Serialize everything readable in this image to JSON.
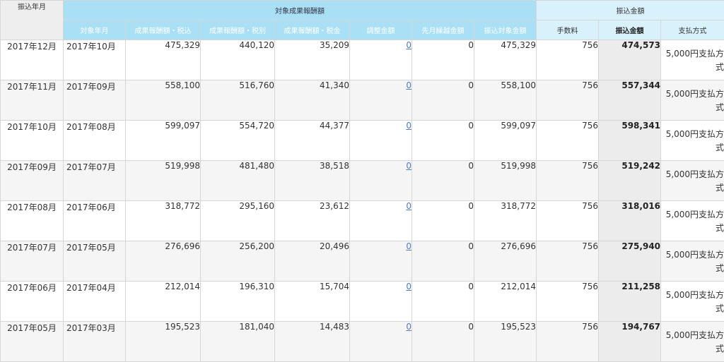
{
  "header": {
    "transfer_month": "振込年月",
    "group_reward": "対象成果報酬額",
    "group_transfer": "振込金額",
    "cols": {
      "target_month": "対象年月",
      "reward_incl_tax": "成果報酬額・税込",
      "reward_excl_tax": "成果報酬額・税別",
      "reward_tax": "成果報酬額・税金",
      "adjustment": "調整金額",
      "carryover": "先月繰越金額",
      "transfer_target": "振込対象金額",
      "fee": "手数料",
      "transfer_amount": "振込金額",
      "payment_method": "支払方式"
    }
  },
  "rows": [
    {
      "transfer_month": "2017年12月",
      "target_month": "2017年10月",
      "incl": "475,329",
      "excl": "440,120",
      "tax": "35,209",
      "adj": "0",
      "carry": "0",
      "target": "475,329",
      "fee": "756",
      "amount": "474,573",
      "method": "5,000円支払方式"
    },
    {
      "transfer_month": "2017年11月",
      "target_month": "2017年09月",
      "incl": "558,100",
      "excl": "516,760",
      "tax": "41,340",
      "adj": "0",
      "carry": "0",
      "target": "558,100",
      "fee": "756",
      "amount": "557,344",
      "method": "5,000円支払方式"
    },
    {
      "transfer_month": "2017年10月",
      "target_month": "2017年08月",
      "incl": "599,097",
      "excl": "554,720",
      "tax": "44,377",
      "adj": "0",
      "carry": "0",
      "target": "599,097",
      "fee": "756",
      "amount": "598,341",
      "method": "5,000円支払方式"
    },
    {
      "transfer_month": "2017年09月",
      "target_month": "2017年07月",
      "incl": "519,998",
      "excl": "481,480",
      "tax": "38,518",
      "adj": "0",
      "carry": "0",
      "target": "519,998",
      "fee": "756",
      "amount": "519,242",
      "method": "5,000円支払方式"
    },
    {
      "transfer_month": "2017年08月",
      "target_month": "2017年06月",
      "incl": "318,772",
      "excl": "295,160",
      "tax": "23,612",
      "adj": "0",
      "carry": "0",
      "target": "318,772",
      "fee": "756",
      "amount": "318,016",
      "method": "5,000円支払方式"
    },
    {
      "transfer_month": "2017年07月",
      "target_month": "2017年05月",
      "incl": "276,696",
      "excl": "256,200",
      "tax": "20,496",
      "adj": "0",
      "carry": "0",
      "target": "276,696",
      "fee": "756",
      "amount": "275,940",
      "method": "5,000円支払方式"
    },
    {
      "transfer_month": "2017年06月",
      "target_month": "2017年04月",
      "incl": "212,014",
      "excl": "196,310",
      "tax": "15,704",
      "adj": "0",
      "carry": "0",
      "target": "212,014",
      "fee": "756",
      "amount": "211,258",
      "method": "5,000円支払方式"
    },
    {
      "transfer_month": "2017年05月",
      "target_month": "2017年03月",
      "incl": "195,523",
      "excl": "181,040",
      "tax": "14,483",
      "adj": "0",
      "carry": "0",
      "target": "195,523",
      "fee": "756",
      "amount": "194,767",
      "method": "5,000円支払方式"
    }
  ]
}
